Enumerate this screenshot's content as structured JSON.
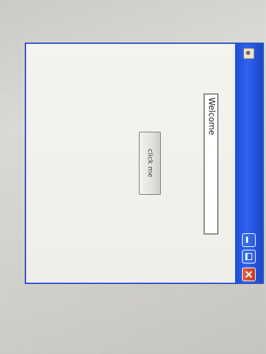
{
  "window": {
    "controls": {
      "icon": "app-icon",
      "minimize": "minimize-icon",
      "maximize": "maximize-icon",
      "close": "close-icon"
    },
    "accent_color": "#2e63f0",
    "close_color": "#d94a2a"
  },
  "text_field": {
    "value": "Welcome"
  },
  "button": {
    "label": "click me"
  }
}
